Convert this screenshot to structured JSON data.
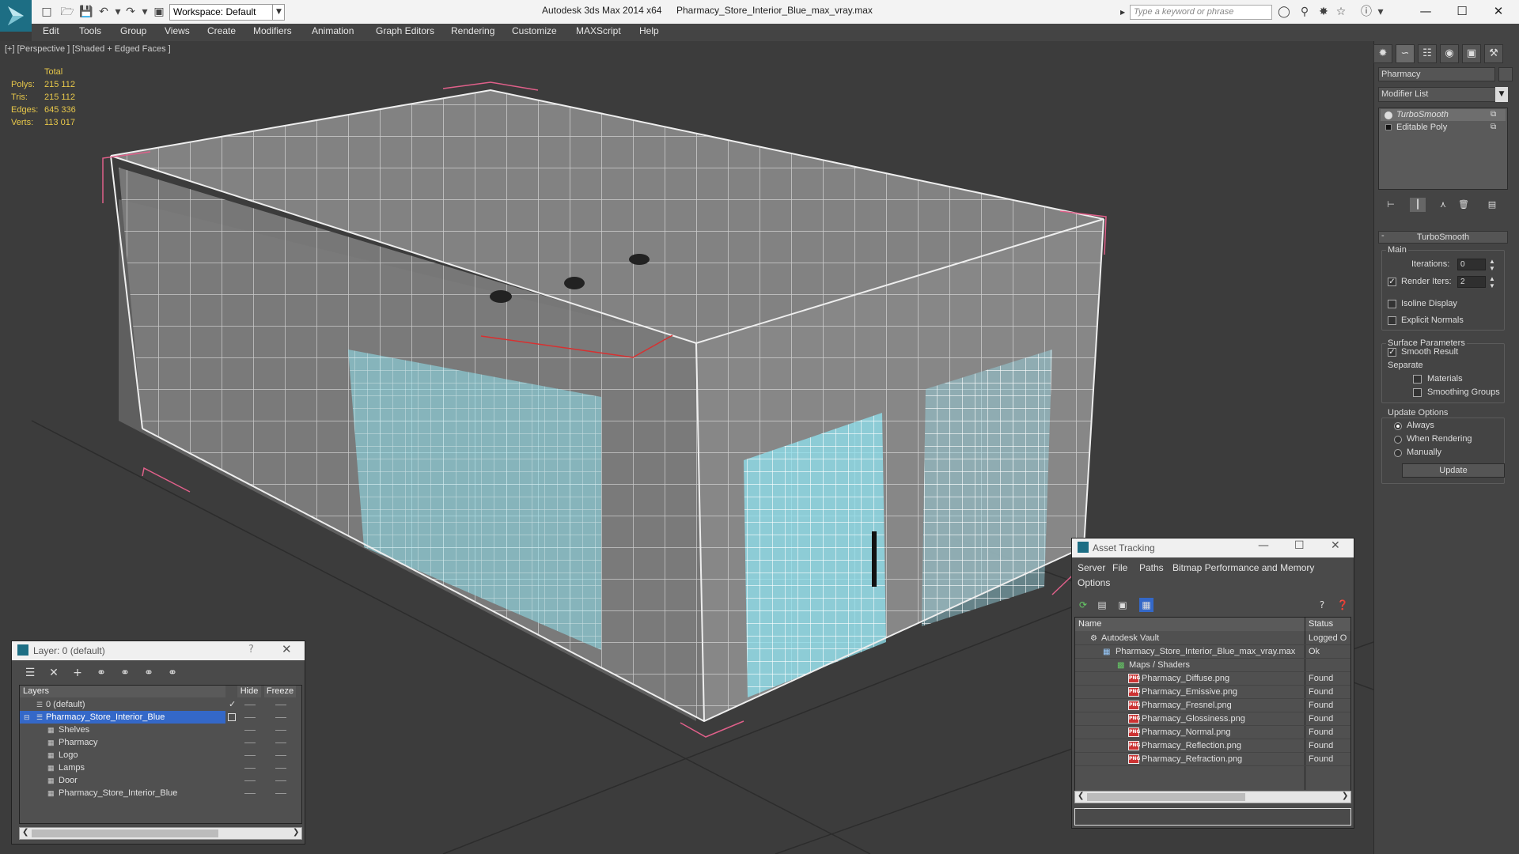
{
  "titlebar": {
    "workspace": "Workspace: Default",
    "app_title": "Autodesk 3ds Max  2014 x64",
    "file_title": "Pharmacy_Store_Interior_Blue_max_vray.max",
    "search_placeholder": "Type a keyword or phrase"
  },
  "menu": [
    "Edit",
    "Tools",
    "Group",
    "Views",
    "Create",
    "Modifiers",
    "Animation",
    "Graph Editors",
    "Rendering",
    "Customize",
    "MAXScript",
    "Help"
  ],
  "viewport": {
    "label": "[+] [Perspective ] [Shaded + Edged Faces ]",
    "stats": {
      "header": "Total",
      "rows": [
        {
          "label": "Polys:",
          "value": "215 112"
        },
        {
          "label": "Tris:",
          "value": "215 112"
        },
        {
          "label": "Edges:",
          "value": "645 336"
        },
        {
          "label": "Verts:",
          "value": "113 017"
        }
      ]
    }
  },
  "command_panel": {
    "object_name": "Pharmacy",
    "modifier_list": "Modifier List",
    "stack": [
      "TurboSmooth",
      "Editable Poly"
    ],
    "rollout": "TurboSmooth",
    "main_group": "Main",
    "iterations_label": "Iterations:",
    "iterations_value": "0",
    "render_iters_label": "Render Iters:",
    "render_iters_value": "2",
    "isoline": "Isoline Display",
    "explicit_normals": "Explicit Normals",
    "surface_group": "Surface Parameters",
    "smooth_result": "Smooth Result",
    "separate": "Separate",
    "materials": "Materials",
    "smoothing_groups": "Smoothing Groups",
    "update_group": "Update Options",
    "always": "Always",
    "when_rendering": "When Rendering",
    "manually": "Manually",
    "update_button": "Update"
  },
  "layer_dialog": {
    "title": "Layer: 0 (default)",
    "help": "?",
    "columns": {
      "layers": "Layers",
      "hide": "Hide",
      "freeze": "Freeze"
    },
    "rows": [
      "0 (default)",
      "Pharmacy_Store_Interior_Blue",
      "Shelves",
      "Pharmacy",
      "Logo",
      "Lamps",
      "Door",
      "Pharmacy_Store_Interior_Blue"
    ]
  },
  "asset_dialog": {
    "title": "Asset Tracking",
    "menu": [
      "Server",
      "File",
      "Paths",
      "Bitmap Performance and Memory",
      "Options"
    ],
    "columns": {
      "name": "Name",
      "status": "Status"
    },
    "rows": [
      {
        "name": "Autodesk Vault",
        "status": "Logged O"
      },
      {
        "name": "Pharmacy_Store_Interior_Blue_max_vray.max",
        "status": "Ok"
      },
      {
        "name": "Maps / Shaders",
        "status": ""
      },
      {
        "name": "Pharmacy_Diffuse.png",
        "status": "Found"
      },
      {
        "name": "Pharmacy_Emissive.png",
        "status": "Found"
      },
      {
        "name": "Pharmacy_Fresnel.png",
        "status": "Found"
      },
      {
        "name": "Pharmacy_Glossiness.png",
        "status": "Found"
      },
      {
        "name": "Pharmacy_Normal.png",
        "status": "Found"
      },
      {
        "name": "Pharmacy_Reflection.png",
        "status": "Found"
      },
      {
        "name": "Pharmacy_Refraction.png",
        "status": "Found"
      }
    ]
  },
  "colors": {
    "accent": "#1d6e84",
    "selection": "#3468c8",
    "stat_text": "#e8c84a",
    "glass": "#8fe3f0"
  }
}
